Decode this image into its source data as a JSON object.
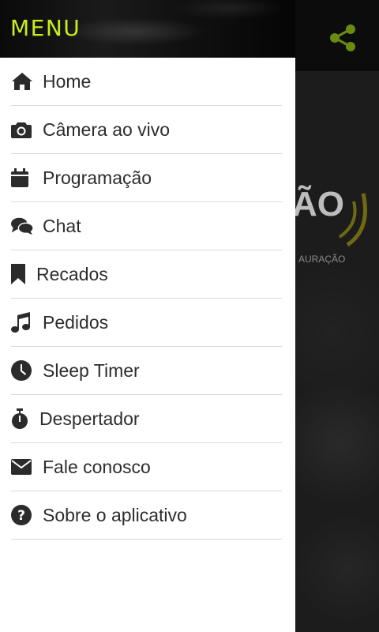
{
  "drawer": {
    "title": "MENU",
    "accent_color": "#c8ee1c",
    "items": [
      {
        "label": "Home",
        "icon": "home-icon"
      },
      {
        "label": "Câmera ao vivo",
        "icon": "camera-icon"
      },
      {
        "label": "Programação",
        "icon": "calendar-icon"
      },
      {
        "label": "Chat",
        "icon": "chat-icon"
      },
      {
        "label": "Recados",
        "icon": "bookmark-icon"
      },
      {
        "label": "Pedidos",
        "icon": "music-note-icon"
      },
      {
        "label": "Sleep Timer",
        "icon": "clock-icon"
      },
      {
        "label": "Despertador",
        "icon": "stopwatch-icon"
      },
      {
        "label": "Fale conosco",
        "icon": "envelope-icon"
      },
      {
        "label": "Sobre o aplicativo",
        "icon": "question-circle-icon"
      }
    ]
  },
  "background": {
    "share_icon": "share-icon",
    "share_color": "#6b8a12",
    "logo_text": "ÃO",
    "logo_subtext": "AURAÇÃO"
  }
}
